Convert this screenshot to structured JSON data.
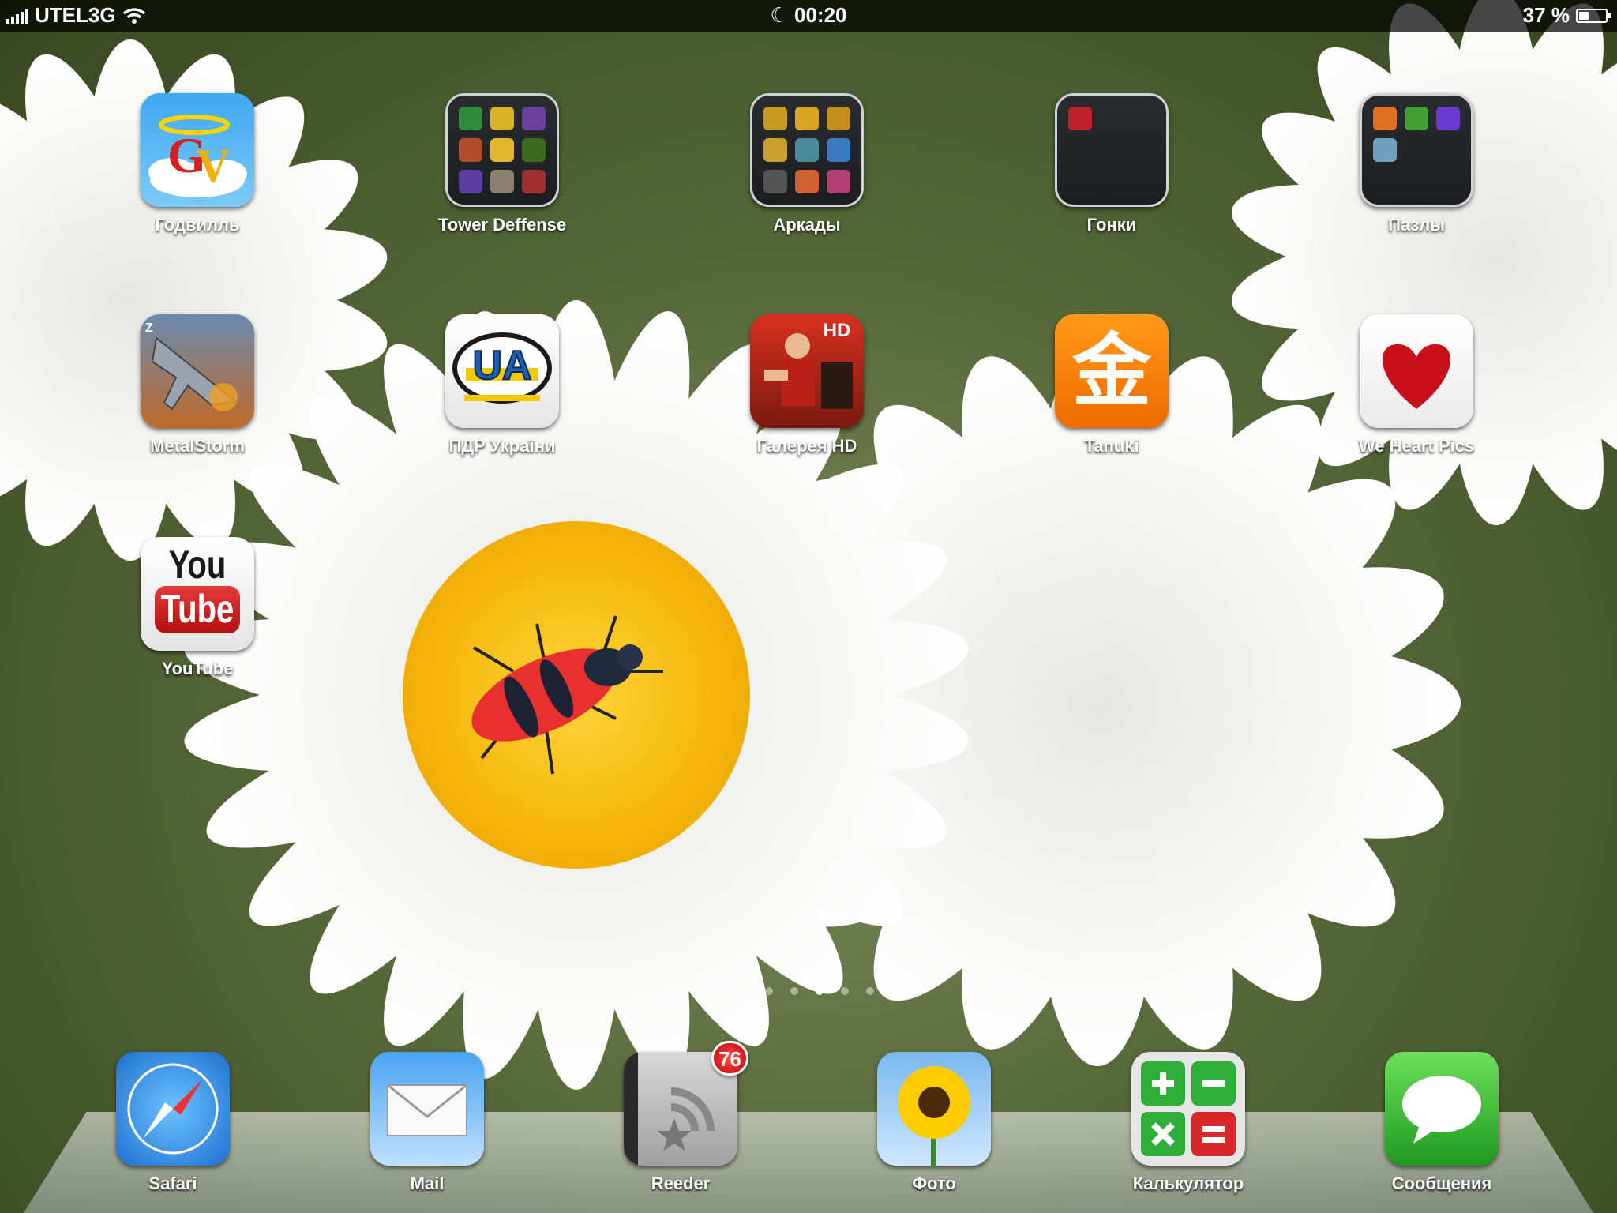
{
  "status_bar": {
    "carrier": "UTEL3G",
    "time": "00:20",
    "battery_percent": "37 %",
    "battery_level": 0.37
  },
  "apps": [
    {
      "label": "Годвилль",
      "icon": "godville-icon",
      "type": "app"
    },
    {
      "label": "Tower Deffense",
      "icon": "folder-icon",
      "type": "folder"
    },
    {
      "label": "Аркады",
      "icon": "folder-icon",
      "type": "folder"
    },
    {
      "label": "Гонки",
      "icon": "folder-icon",
      "type": "folder"
    },
    {
      "label": "Пазлы",
      "icon": "folder-icon",
      "type": "folder"
    },
    {
      "label": "MetalStorm",
      "icon": "jet-fighter-icon",
      "type": "app"
    },
    {
      "label": "ПДР України",
      "icon": "ua-badge-icon",
      "type": "app",
      "icon_text": "UA"
    },
    {
      "label": "Галерея HD",
      "icon": "poster-icon",
      "type": "app",
      "icon_text": "HD"
    },
    {
      "label": "Tanuki",
      "icon": "kanji-icon",
      "type": "app",
      "icon_text": "金"
    },
    {
      "label": "We Heart Pics",
      "icon": "heart-icon",
      "type": "app"
    },
    {
      "label": "YouTube",
      "icon": "youtube-icon",
      "type": "app",
      "icon_text_1": "You",
      "icon_text_2": "Tube"
    }
  ],
  "page_indicator": {
    "pages": 7,
    "current": 4
  },
  "dock": [
    {
      "label": "Safari",
      "icon": "compass-icon"
    },
    {
      "label": "Mail",
      "icon": "envelope-icon"
    },
    {
      "label": "Reeder",
      "icon": "rss-star-icon",
      "badge": "76"
    },
    {
      "label": "Фото",
      "icon": "sunflower-icon"
    },
    {
      "label": "Калькулятор",
      "icon": "calculator-icon"
    },
    {
      "label": "Сообщения",
      "icon": "speech-bubble-icon"
    }
  ]
}
